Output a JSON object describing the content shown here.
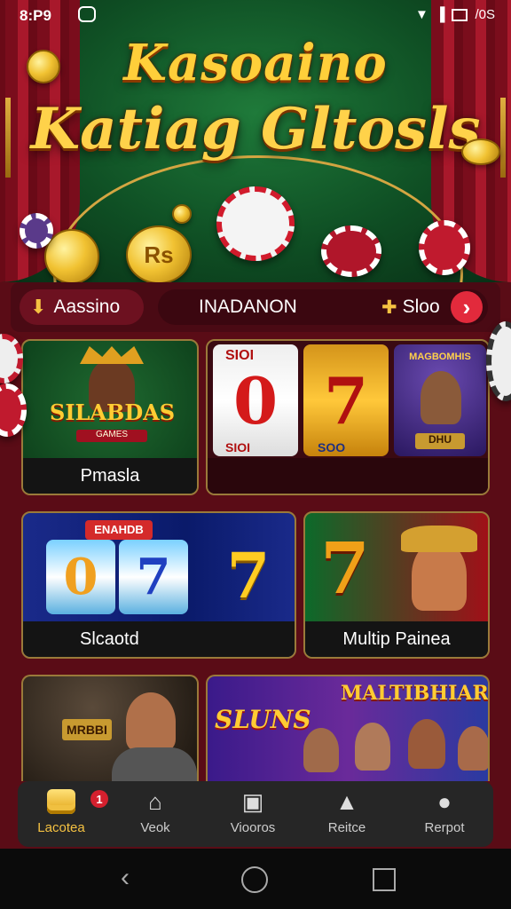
{
  "status_bar": {
    "time": "8:P9",
    "battery_text": "/0S"
  },
  "hero": {
    "title_line1": "Kasoaino",
    "title_line2": "Katiag Gltosls",
    "coin_text": "Rs"
  },
  "tabs": {
    "left_label": "Aassino",
    "center_label": "INADANON",
    "right_label": "Sloo"
  },
  "cards": {
    "card1": {
      "label": "Pmasla",
      "logo_text": "SILABDAS",
      "logo_sub": "GAMES"
    },
    "card2": {
      "reel_top": "SIOI",
      "reel_bottom": "SIOI",
      "reel_sub": "SOO",
      "symbol_a": "0",
      "symbol_b": "7",
      "banner": "MAGBOMHIS",
      "sign": "DHU"
    },
    "card3": {
      "label": "Slcaotd",
      "banner": "ENAHDB",
      "reel_a": "0",
      "reel_b": "7",
      "reel_c": "7"
    },
    "card4": {
      "label": "Multip Painea",
      "symbol": "7"
    },
    "card5": {
      "sign": "MRBBI"
    },
    "card6": {
      "title": "MALTIBHIARS",
      "sub": "SLUNS"
    }
  },
  "bottom_nav": [
    {
      "label": "Lacotea",
      "icon": "coins-icon",
      "badge": "1"
    },
    {
      "label": "Veok",
      "icon": "home-icon"
    },
    {
      "label": "Viooros",
      "icon": "video-icon"
    },
    {
      "label": "Reitce",
      "icon": "user-icon"
    },
    {
      "label": "Rerpot",
      "icon": "support-icon"
    }
  ],
  "colors": {
    "accent": "#f5c242",
    "brand": "#7a0d1c",
    "next_button": "#e22a3c"
  }
}
